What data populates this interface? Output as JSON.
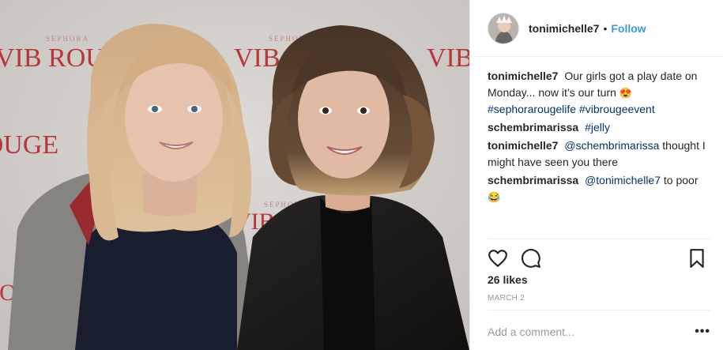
{
  "post": {
    "username": "tonimichelle7",
    "separator": "•",
    "follow_label": "Follow",
    "likes": "26 likes",
    "date": "MARCH 2"
  },
  "photo": {
    "backdrop_brand": "SEPHORA",
    "backdrop_text": "VIB ROUGE",
    "colors": {
      "backdrop": "#dedbd8",
      "brand_red": "#c0393b"
    }
  },
  "comments": [
    {
      "user": "tonimichelle7",
      "text": "Our girls got a play date on Monday... now it’s our turn",
      "emoji": "😍",
      "tags": [
        "#sephorarougelife",
        "#vibrougeevent"
      ]
    },
    {
      "user": "schembrimarissa",
      "tag": "#jelly"
    },
    {
      "user": "tonimichelle7",
      "mention": "@schembrimarissa",
      "text": "thought I might have seen you there"
    },
    {
      "user": "schembrimarissa",
      "mention": "@tonimichelle7",
      "text": "to poor",
      "emoji": "😂"
    }
  ],
  "add_comment": {
    "placeholder": "Add a comment..."
  },
  "more_label": "•••",
  "icons": {
    "like": "heart-icon",
    "comment": "comment-icon",
    "save": "bookmark-icon",
    "more": "more-options-icon"
  }
}
